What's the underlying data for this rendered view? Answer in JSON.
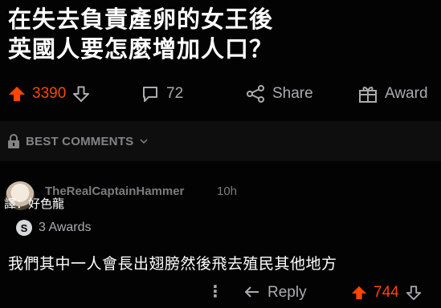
{
  "post": {
    "title_line1": "在失去負責產卵的女王後",
    "title_line2": "英國人要怎麼增加人口？"
  },
  "actions": {
    "upvote_count": "3390",
    "comment_count": "72",
    "share_label": "Share",
    "award_label": "Award"
  },
  "best_comments_label": "BEST COMMENTS",
  "comment": {
    "username": "TheRealCaptainHammer",
    "time": "10h",
    "translator_note": "譯：好色龍",
    "awards_label": "3 Awards",
    "body": "我們其中一人會長出翅膀然後飛去殖民其他地方",
    "reply_label": "Reply",
    "vote_count": "744"
  },
  "colors": {
    "upvote": "#ff4500",
    "text_muted": "#a9acae",
    "background": "#030303"
  },
  "icons": [
    "upvote-icon",
    "downvote-icon",
    "comment-icon",
    "share-icon",
    "award-icon",
    "lock-icon",
    "chevron-down-icon",
    "more-icon",
    "reply-icon"
  ]
}
